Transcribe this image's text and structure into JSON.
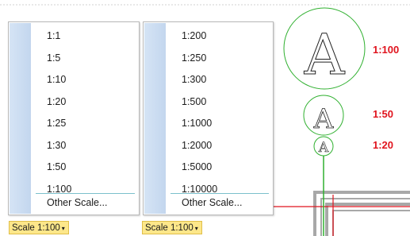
{
  "menu_left": {
    "items": [
      "1:1",
      "1:5",
      "1:10",
      "1:20",
      "1:25",
      "1:30",
      "1:50",
      "1:100"
    ],
    "other": "Other Scale..."
  },
  "menu_right": {
    "items": [
      "1:200",
      "1:250",
      "1:300",
      "1:500",
      "1:1000",
      "1:2000",
      "1:5000",
      "1:10000"
    ],
    "other": "Other Scale..."
  },
  "statusbar": {
    "scale_left": "Scale 1:100",
    "scale_right": "Scale 1:100"
  },
  "drawing": {
    "letter": "A",
    "labels": {
      "large": "1:100",
      "medium": "1:50",
      "small": "1:20"
    },
    "colors": {
      "circle": "#2fb02f",
      "label": "#e0141e",
      "line_red": "#e0141e",
      "line_green": "#2fb02f",
      "wall": "#a8a8a8"
    }
  }
}
